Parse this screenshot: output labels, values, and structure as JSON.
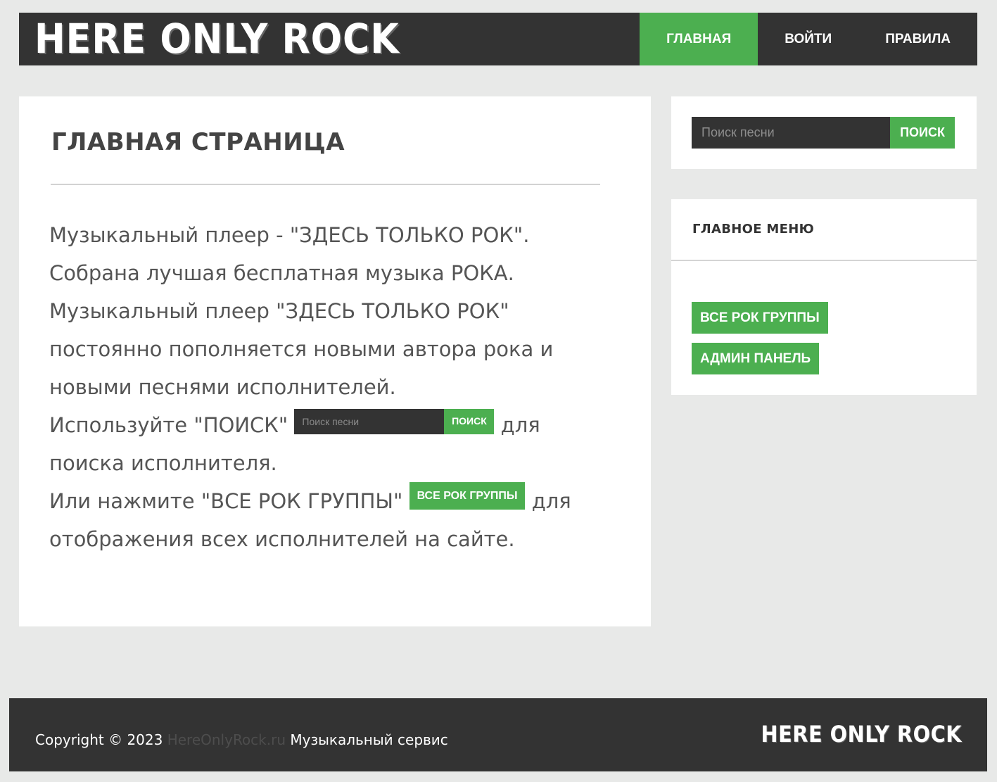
{
  "header": {
    "logo": "HERE ONLY ROCK",
    "nav": [
      {
        "label": "ГЛАВНАЯ",
        "active": true
      },
      {
        "label": "ВОЙТИ",
        "active": false
      },
      {
        "label": "ПРАВИЛА",
        "active": false
      }
    ]
  },
  "main": {
    "title": "ГЛАВНАЯ СТРАНИЦА",
    "paragraph_1": "Музыкальный плеер - \"ЗДЕСЬ ТОЛЬКО РОК\". Собрана лучшая бесплатная музыка РОКА. Музыкальный плеер \"ЗДЕСЬ ТОЛЬКО РОК\" постоянно пополняется новыми автора рока и новыми песнями исполнителей.",
    "search_line_before": "Используйте \"ПОИСК\"",
    "search_line_after": "для поиска исполнителя.",
    "inline_search_placeholder": "Поиск песни",
    "inline_search_button": "ПОИСК",
    "groups_line_before": "Или нажмите \"ВСЕ РОК ГРУППЫ\"",
    "groups_line_after": "для отображения всех исполнителей на сайте.",
    "inline_groups_button": "ВСЕ РОК ГРУППЫ"
  },
  "sidebar": {
    "search": {
      "placeholder": "Поиск песни",
      "button": "ПОИСК"
    },
    "menu": {
      "title": "ГЛАВНОЕ МЕНЮ",
      "items": [
        {
          "label": "ВСЕ РОК ГРУППЫ"
        },
        {
          "label": "АДМИН ПАНЕЛЬ"
        }
      ]
    }
  },
  "footer": {
    "copyright": "Copyright © 2023",
    "site": "HereOnlyRock.ru",
    "tagline": "Музыкальный сервис",
    "logo": "HERE ONLY ROCK"
  },
  "colors": {
    "accent": "#4caf50",
    "dark": "#333333",
    "background": "#e8e9e8"
  }
}
